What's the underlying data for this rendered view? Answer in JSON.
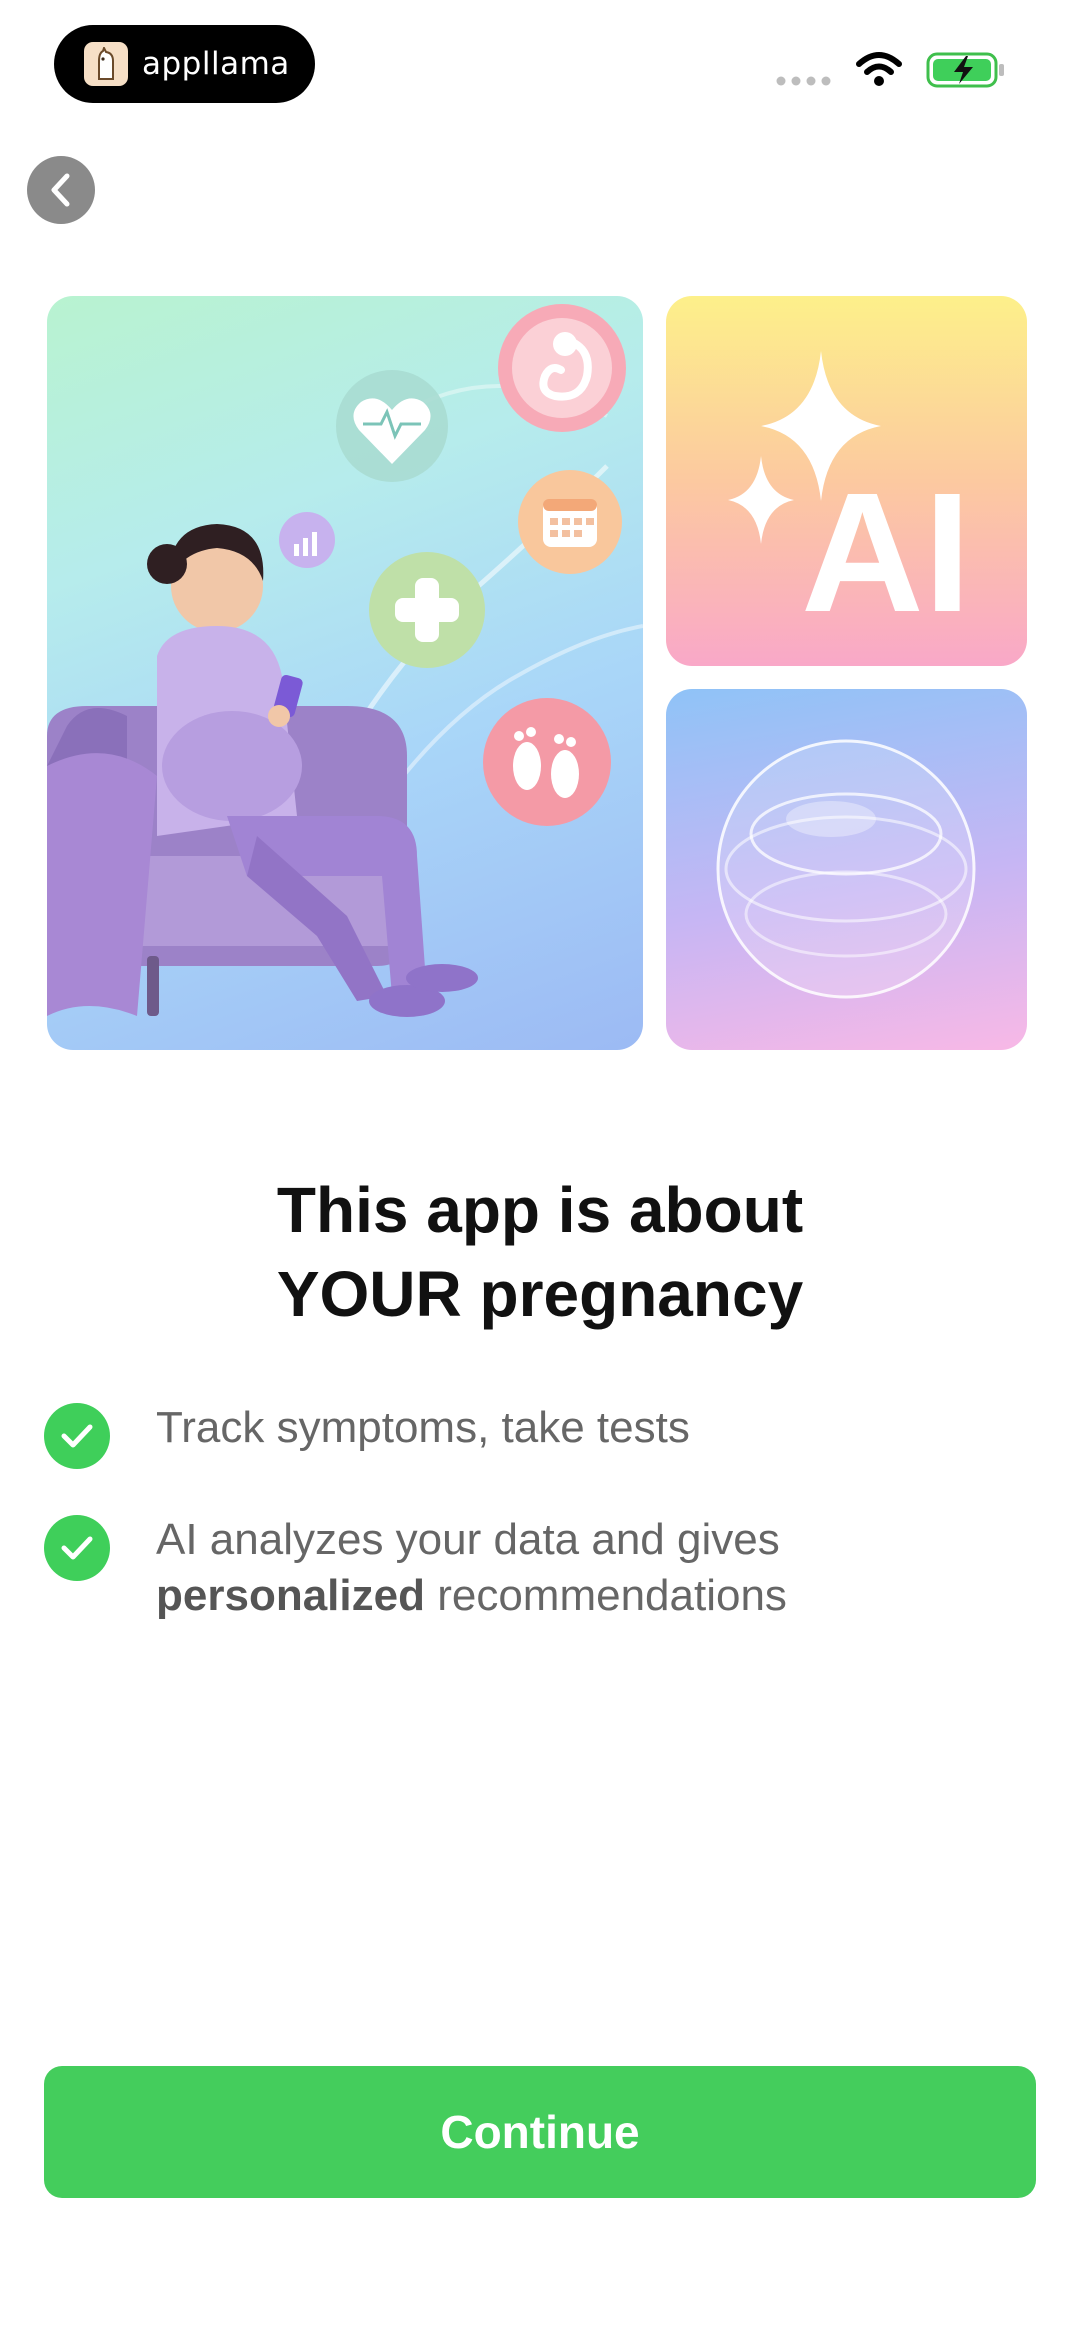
{
  "status_bar": {
    "brand_name": "appllama",
    "icons": [
      "cellular-signal-icon",
      "wifi-icon",
      "battery-charging-icon"
    ]
  },
  "navigation": {
    "back_icon": "chevron-left-icon"
  },
  "hero": {
    "ai_tile_text": "AI",
    "icons": [
      "heart-pulse-icon",
      "fetus-icon",
      "calendar-icon",
      "plus-icon",
      "baby-feet-icon",
      "chart-icon",
      "sparkle-icon"
    ]
  },
  "headline": {
    "line1": "This app is about",
    "line2": "YOUR pregnancy"
  },
  "features": [
    {
      "text": "Track symptoms, take tests"
    },
    {
      "line1": "AI analyzes your data and gives",
      "bold": "personalized",
      "rest": " recommendations"
    }
  ],
  "continue_label": "Continue",
  "colors": {
    "accent_green": "#44cd5c",
    "check_green": "#3fcf5a",
    "text_dark": "#111111",
    "text_gray": "#666666"
  }
}
